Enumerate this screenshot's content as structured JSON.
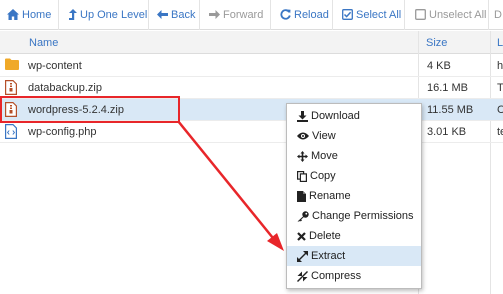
{
  "toolbar": {
    "home": "Home",
    "up_one_level": "Up One Level",
    "back": "Back",
    "forward": "Forward",
    "reload": "Reload",
    "select_all": "Select All",
    "unselect_all": "Unselect All",
    "more": "D"
  },
  "columns": {
    "name": "Name",
    "size": "Size",
    "extra": "L"
  },
  "files": [
    {
      "name": "wp-content",
      "size": "4 KB",
      "extra": "ht",
      "icon": "folder-icon"
    },
    {
      "name": "databackup.zip",
      "size": "16.1 MB",
      "extra": "T",
      "icon": "zip-file-icon"
    },
    {
      "name": "wordpress-5.2.4.zip",
      "size": "11.55 MB",
      "extra": "C",
      "icon": "zip-file-icon",
      "selected": true
    },
    {
      "name": "wp-config.php",
      "size": "3.01 KB",
      "extra": "te",
      "icon": "php-file-icon"
    }
  ],
  "context_menu": {
    "items": [
      {
        "label": "Download",
        "icon": "download-icon"
      },
      {
        "label": "View",
        "icon": "eye-icon"
      },
      {
        "label": "Move",
        "icon": "move-arrows-icon"
      },
      {
        "label": "Copy",
        "icon": "copy-icon"
      },
      {
        "label": "Rename",
        "icon": "file-icon"
      },
      {
        "label": "Change Permissions",
        "icon": "key-icon"
      },
      {
        "label": "Delete",
        "icon": "x-icon"
      },
      {
        "label": "Extract",
        "icon": "expand-icon",
        "highlighted": true
      },
      {
        "label": "Compress",
        "icon": "compress-icon"
      }
    ]
  },
  "colors": {
    "link_blue": "#3a76c4",
    "selection": "#d9e8f6",
    "annotation_red": "#e8262a",
    "folder": "#f0a928",
    "zip_icon": "#b5502a",
    "php_icon": "#3a76c4"
  }
}
